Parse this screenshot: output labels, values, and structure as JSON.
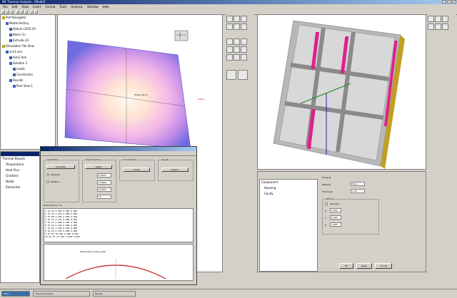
{
  "app": {
    "title": "NX Thermal Analysis - [Model]",
    "menu": [
      "File",
      "Edit",
      "View",
      "Insert",
      "Format",
      "Tools",
      "Analysis",
      "Window",
      "Help"
    ]
  },
  "tree": {
    "items": [
      {
        "label": "Part Navigator",
        "indent": 0
      },
      {
        "label": "Model History",
        "indent": 1
      },
      {
        "label": "Datum CSYS (0)",
        "indent": 2
      },
      {
        "label": "Block (1)",
        "indent": 2
      },
      {
        "label": "Extrude (2)",
        "indent": 2
      },
      {
        "label": "Simulation File View",
        "indent": 0
      },
      {
        "label": "sim1.sim",
        "indent": 1
      },
      {
        "label": "fem1.fem",
        "indent": 2
      },
      {
        "label": "Solution 1",
        "indent": 2
      },
      {
        "label": "Loads",
        "indent": 3
      },
      {
        "label": "Constraints",
        "indent": 3
      },
      {
        "label": "Results",
        "indent": 2
      },
      {
        "label": "Post View 1",
        "indent": 3
      }
    ]
  },
  "tree2": {
    "items": [
      {
        "label": "Thermal Results"
      },
      {
        "label": "Temperature"
      },
      {
        "label": "Heat Flux"
      },
      {
        "label": "Gradient"
      },
      {
        "label": "Nodal"
      },
      {
        "label": "Elemental"
      }
    ]
  },
  "left_view": {
    "label1": "Probe (24.3)",
    "label2": "Datum"
  },
  "dialog": {
    "groups": [
      "Quantities",
      "Probe Options",
      "Coordinates",
      "Display"
    ],
    "buttons": [
      "Calculate",
      "Apply",
      "Graph",
      "Export"
    ],
    "options": [
      "Absolute",
      "Relative"
    ],
    "fields": [
      "0.0000",
      "1.0000",
      "2.0000",
      "10"
    ],
    "list_header": "Node   Temp     X       Y       Z",
    "rows": [
      "1   24.31  0.000  0.000  0.000",
      "2   24.56  1.250  0.000  0.000",
      "3   24.88  2.500  0.000  0.000",
      "4   25.12  3.750  0.000  0.000",
      "5   25.47  5.000  0.000  0.000",
      "6   25.69  6.250  0.000  0.000",
      "7   25.83  7.500  0.000  0.000",
      "8   25.91  8.750  0.000  0.000",
      "9   25.95 10.000  0.000  0.000",
      "10  25.97 11.250  0.000  0.000"
    ],
    "graph_title": "Temperature along path"
  },
  "bottom_panel": {
    "tree_items": [
      "Component",
      "Housing",
      "Cavity"
    ],
    "labels": [
      "Property",
      "Material",
      "Thickness",
      "Options",
      "Direction",
      "X",
      "Y",
      "Z"
    ],
    "fields": [
      "Steel",
      "2.00",
      "0.000",
      "0.000",
      "1.000"
    ],
    "buttons": [
      "OK",
      "Apply",
      "Cancel"
    ]
  },
  "status": {
    "tasks": [
      "Start",
      "Thermal Analysis",
      "Results"
    ]
  },
  "colors": {
    "title_start": "#0a246a",
    "title_end": "#a6caf0",
    "contour_hot": "#ffe6d5",
    "contour_cold": "#7f6be0",
    "wall": "#c8c8c8",
    "magenta": "#e0208a",
    "frame_yellow": "#c0a020"
  }
}
